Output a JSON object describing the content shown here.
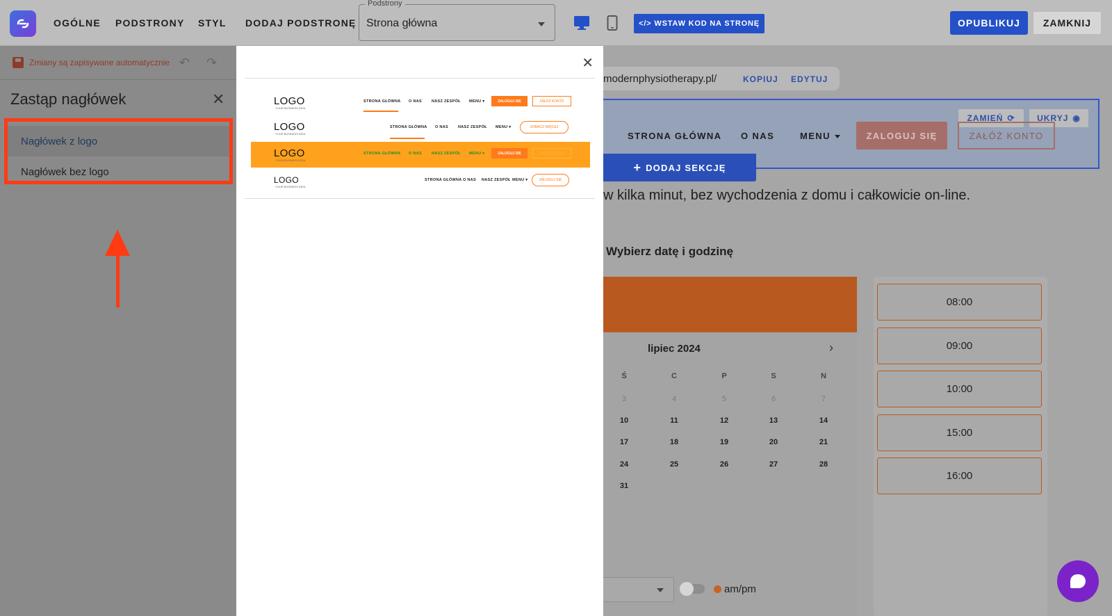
{
  "topbar": {
    "nav": [
      "OGÓLNE",
      "PODSTRONY",
      "STYL",
      "DODAJ PODSTRONĘ"
    ],
    "subpage_label": "Podstrony",
    "subpage_value": "Strona główna",
    "embed_label": "WSTAW KOD NA STRONĘ",
    "publish_label": "OPUBLIKUJ",
    "close_label": "ZAMKNIJ"
  },
  "panel": {
    "autosave": "Zmiany są zapisywane automatycznie",
    "title": "Zastąp nagłówek",
    "options": [
      "Nagłówek z logo",
      "Nagłówek bez logo"
    ]
  },
  "preview": {
    "logo": "LOGO",
    "tagline": "YOUR BUSINESS IDEA",
    "nav_home": "STRONA GŁÓWNA",
    "nav_about": "O NAS",
    "nav_team": "NASZ ZESPÓŁ",
    "nav_menu": "MENU ▾",
    "login": "ZALOGUJ SIĘ",
    "signup": "ZAŁÓŻ KONTO",
    "see_more": "ZOBACZ WIĘCEJ"
  },
  "canvas": {
    "url": "modernphysiotherapy.pl/",
    "copy_label": "KOPIUJ",
    "edit_label": "EDYTUJ",
    "swap_label": "ZAMIEŃ",
    "hide_label": "UKRYJ",
    "nav": [
      "STRONA GŁÓWNA",
      "O NAS",
      "MENU"
    ],
    "login": "ZALOGUJ SIĘ",
    "signup": "ZAŁÓŻ KONTO",
    "add_section": "DODAJ SEKCJĘ",
    "intro": "w kilka minut, bez wychodzenia z domu i całkowicie on-line.",
    "pick_date": "Wybierz datę i godzinę",
    "month": "lipiec 2024",
    "weekdays": [
      "Ś",
      "C",
      "P",
      "S",
      "N"
    ],
    "weeks": [
      [
        "3",
        "4",
        "5",
        "6",
        "7"
      ],
      [
        "10",
        "11",
        "12",
        "13",
        "14"
      ],
      [
        "17",
        "18",
        "19",
        "20",
        "21"
      ],
      [
        "24",
        "25",
        "26",
        "27",
        "28"
      ],
      [
        "31"
      ]
    ],
    "times": [
      "08:00",
      "09:00",
      "10:00",
      "15:00",
      "16:00"
    ],
    "ampm": "am/pm"
  },
  "colors": {
    "accent_blue": "#2450c8",
    "annotation_red": "#ff3b14",
    "brand_orange": "#ff7a1a"
  }
}
